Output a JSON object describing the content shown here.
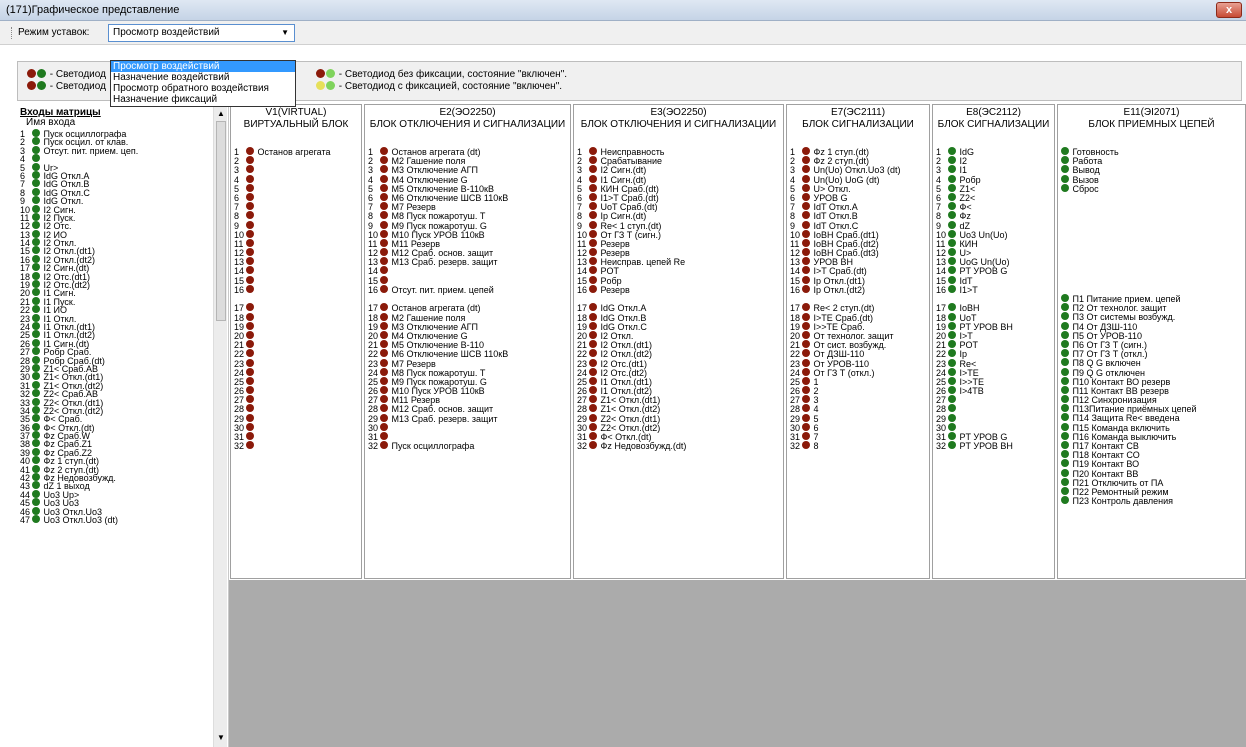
{
  "window": {
    "title": "(171)Графическое представление",
    "close": "x"
  },
  "toolbar": {
    "mode_label": "Режим уставок:",
    "mode_value": "Просмотр воздействий"
  },
  "dropdown": [
    "Просмотр воздействий",
    "Назначение воздействий",
    "Просмотр обратного воздействия",
    "Назначение фиксаций"
  ],
  "legend": {
    "a": " - Светодиод",
    "b": " - Светодиод",
    "c": " - Светодиод без фиксации, состояние \"включен\".",
    "d": " - Светодиод с фиксацией, состояние \"включен\"."
  },
  "left": {
    "title": "Входы матрицы",
    "subtitle": "Имя входа",
    "items": [
      [
        "1",
        "g",
        "Пуск осциллографа"
      ],
      [
        "2",
        "g",
        "Пуск осцил. от клав."
      ],
      [
        "3",
        "g",
        "Отсут. пит. прием. цеп."
      ],
      [
        "4",
        "g",
        ""
      ],
      [
        "5",
        "g",
        "Ur>"
      ],
      [
        "6",
        "g",
        "IdG Откл.A"
      ],
      [
        "7",
        "g",
        "IdG Откл.B"
      ],
      [
        "8",
        "g",
        "IdG Откл.C"
      ],
      [
        "9",
        "g",
        "IdG Откл."
      ],
      [
        "10",
        "g",
        "I2 Сигн."
      ],
      [
        "11",
        "g",
        "I2 Пуск."
      ],
      [
        "12",
        "g",
        "I2 Отс."
      ],
      [
        "13",
        "g",
        "I2 ИО"
      ],
      [
        "14",
        "g",
        "I2 Откл."
      ],
      [
        "15",
        "g",
        "I2 Откл.(dt1)"
      ],
      [
        "16",
        "g",
        "I2 Откл.(dt2)"
      ],
      [
        "17",
        "g",
        "I2 Сигн.(dt)"
      ],
      [
        "18",
        "g",
        "I2 Отс.(dt1)"
      ],
      [
        "19",
        "g",
        "I2 Отс.(dt2)"
      ],
      [
        "20",
        "g",
        "I1 Сигн."
      ],
      [
        "21",
        "g",
        "I1 Пуск."
      ],
      [
        "22",
        "g",
        "I1 ИО"
      ],
      [
        "23",
        "g",
        "I1 Откл."
      ],
      [
        "24",
        "g",
        "I1 Откл.(dt1)"
      ],
      [
        "25",
        "g",
        "I1 Откл.(dt2)"
      ],
      [
        "26",
        "g",
        "I1 Сигн.(dt)"
      ],
      [
        "27",
        "g",
        "Pобр Сраб."
      ],
      [
        "28",
        "g",
        "Pобр Сраб.(dt)"
      ],
      [
        "29",
        "g",
        "Z1< Сраб.AB"
      ],
      [
        "30",
        "g",
        "Z1< Откл.(dt1)"
      ],
      [
        "31",
        "g",
        "Z1< Откл.(dt2)"
      ],
      [
        "32",
        "g",
        "Z2< Сраб.AB"
      ],
      [
        "33",
        "g",
        "Z2< Откл.(dt1)"
      ],
      [
        "34",
        "g",
        "Z2< Откл.(dt2)"
      ],
      [
        "35",
        "g",
        "Ф< Сраб."
      ],
      [
        "36",
        "g",
        "Ф< Откл.(dt)"
      ],
      [
        "37",
        "g",
        "Фz Сраб.W"
      ],
      [
        "38",
        "g",
        "Фz Сраб.Z1"
      ],
      [
        "39",
        "g",
        "Фz Сраб.Z2"
      ],
      [
        "40",
        "g",
        "Фz 1 ступ.(dt)"
      ],
      [
        "41",
        "g",
        "Фz 2 ступ.(dt)"
      ],
      [
        "42",
        "g",
        "Фz Недовозбужд."
      ],
      [
        "43",
        "g",
        "dZ 1 выход"
      ],
      [
        "44",
        "g",
        "Uo3 Up>"
      ],
      [
        "45",
        "g",
        "Uo3 Uo3"
      ],
      [
        "46",
        "g",
        "Uo3 Откл.Uo3"
      ],
      [
        "47",
        "g",
        "Uo3 Откл.Uo3 (dt)"
      ]
    ]
  },
  "columns": [
    {
      "h1": "V1(VIRTUAL)",
      "h2": "ВИРТУАЛЬНЫЙ БЛОК",
      "num": true,
      "c": "r",
      "items": [
        "Останов агрегата",
        "",
        "",
        "",
        "",
        "",
        "",
        "",
        "",
        "",
        "",
        "",
        "",
        "",
        "",
        "",
        "",
        "",
        "",
        "",
        "",
        "",
        "",
        "",
        "",
        "",
        "",
        "",
        "",
        "",
        "",
        ""
      ]
    },
    {
      "h1": "E2(ЭО2250)",
      "h2": "БЛОК ОТКЛЮЧЕНИЯ И СИГНАЛИЗАЦИИ",
      "num": true,
      "c": "r",
      "items": [
        "Останов агрегата (dt)",
        "М2 Гашение поля",
        "М3 Отключение АГП",
        "М4 Отключение G",
        "М5 Отключение В-110кВ",
        "М6 Отключение ШСВ 110кВ",
        "М7 Резерв",
        "М8 Пуск пожаротуш. Т",
        "М9 Пуск пожаротуш. G",
        "М10 Пуск УРОВ 110кВ",
        "М11 Резерв",
        "М12 Сраб. основ. защит",
        "М13 Сраб. резерв. защит",
        "",
        "",
        "Отсут. пит. прием. цепей",
        "Останов агрегата (dt)",
        "М2 Гашение поля",
        "М3 Отключение АГП",
        "М4 Отключение G",
        "М5 Отключение В-110",
        "М6 Отключение ШСВ 110кВ",
        "М7 Резерв",
        "М8 Пуск пожаротуш. Т",
        "М9 Пуск пожаротуш. G",
        "М10 Пуск УРОВ 110кВ",
        "М11 Резерв",
        "М12 Сраб. основ. защит",
        "М13 Сраб. резерв. защит",
        "",
        "",
        "Пуск осциллографа"
      ]
    },
    {
      "h1": "E3(ЭО2250)",
      "h2": "БЛОК ОТКЛЮЧЕНИЯ И СИГНАЛИЗАЦИИ",
      "num": true,
      "c": "r",
      "items": [
        "Неисправность",
        "Срабатывание",
        "I2 Сигн.(dt)",
        "I1 Сигн.(dt)",
        "КИН Сраб.(dt)",
        "I1>T Сраб.(dt)",
        "UoT Сраб.(dt)",
        "Ip Сигн.(dt)",
        "Re< 1 ступ.(dt)",
        "От ГЗ Т (сигн.)",
        "Резерв",
        "Резерв",
        "Неисправ. цепей Re",
        "POT",
        "Pобр",
        "Резерв",
        "IdG Откл.A",
        "IdG Откл.B",
        "IdG Откл.C",
        "I2 Откл.",
        "I2 Откл.(dt1)",
        "I2 Откл.(dt2)",
        "I2 Отс.(dt1)",
        "I2 Отс.(dt2)",
        "I1 Откл.(dt1)",
        "I1 Откл.(dt2)",
        "Z1< Откл.(dt1)",
        "Z1< Откл.(dt2)",
        "Z2< Откл.(dt1)",
        "Z2< Откл.(dt2)",
        "Ф< Откл.(dt)",
        "Фz Недовозбужд.(dt)"
      ]
    },
    {
      "h1": "E7(ЭС2111)",
      "h2": "БЛОК СИГНАЛИЗАЦИИ",
      "num": true,
      "c": "r",
      "items": [
        "Фz 1 ступ.(dt)",
        "Фz 2 ступ.(dt)",
        "Un(Uo) Откл.Uo3 (dt)",
        "Un(Uo) UoG (dt)",
        "U> Откл.",
        "УРОВ G",
        "IdT Откл.A",
        "IdT Откл.B",
        "IdT Откл.C",
        "IoBH Сраб.(dt1)",
        "IoBH Сраб.(dt2)",
        "IoBH Сраб.(dt3)",
        "УРОВ ВН",
        "I>T Сраб.(dt)",
        "Ip Откл.(dt1)",
        "Ip Откл.(dt2)",
        "Re< 2 ступ.(dt)",
        "I>TE Сраб.(dt)",
        "I>>TE Сраб.",
        "От технолог. защит",
        "От сист. возбужд.",
        "От ДЗШ-110",
        "От УРОВ-110",
        "От ГЗ Т (откл.)",
        "1",
        "2",
        "3",
        "4",
        "5",
        "6",
        "7",
        "8"
      ]
    },
    {
      "h1": "E8(ЭС2112)",
      "h2": "БЛОК СИГНАЛИЗАЦИИ",
      "num": true,
      "c": "g",
      "items": [
        "IdG",
        "I2",
        "I1",
        "Pобр",
        "Z1<",
        "Z2<",
        "Ф<",
        "Фz",
        "dZ",
        "Uo3 Un(Uo)",
        "КИН",
        "U>",
        "UoG Un(Uo)",
        "PT УРОВ G",
        "IdT",
        "I1>T",
        "IoBH",
        "UoT",
        "PT УРОВ ВН",
        "I>T",
        "POT",
        "Ip",
        "Re<",
        "I>TE",
        "I>>TE",
        "I>4TB",
        "",
        "",
        "",
        "",
        "PT УРОВ G",
        "PT УРОВ ВН"
      ]
    },
    {
      "h1": "E11(ЭI2071)",
      "h2": "БЛОК ПРИЕМНЫХ ЦЕПЕЙ",
      "num": false,
      "c": "g",
      "items": [
        "Готовность",
        "Работа",
        "Вывод",
        "Вызов",
        "Сброс",
        "",
        "",
        "",
        "",
        "",
        "",
        "",
        "",
        "",
        "",
        "",
        "П1 Питание прием. цепей",
        "П2 От технолог. защит",
        "П3 От системы возбужд.",
        "П4 От ДЗШ-110",
        "П5 От УРОВ-110",
        "П6 От ГЗ Т (сигн.)",
        "П7 От ГЗ Т (откл.)",
        "П8 Q G включен",
        "П9 Q G отключен",
        "П10 Контакт ВО резерв",
        "П11 Контакт ВВ резерв",
        "П12 Синхронизация",
        "П13Питание приёмных цепей",
        "П14 Защита Re< введена",
        "П15 Команда включить",
        "П16 Команда выключить",
        "П17 Контакт СВ",
        "П18 Контакт СО",
        "П19 Контакт ВО",
        "П20 Контакт ВВ",
        "П21 Отключить от ПА",
        "П22 Ремонтный режим",
        "П23 Контроль давления"
      ]
    }
  ],
  "colors": {
    "red": "#8b1a0a",
    "green": "#1f7a1f"
  }
}
